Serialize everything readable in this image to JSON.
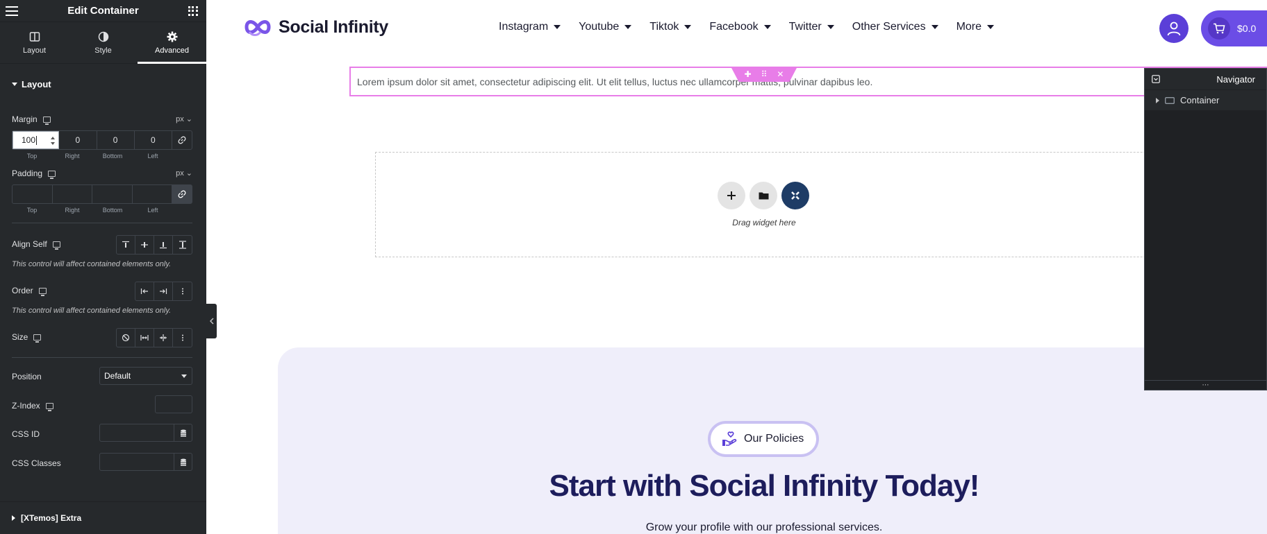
{
  "panel": {
    "title": "Edit Container",
    "tabs": [
      {
        "label": "Layout"
      },
      {
        "label": "Style"
      },
      {
        "label": "Advanced"
      }
    ],
    "section_title": "Layout",
    "margin": {
      "label": "Margin",
      "unit": "px",
      "values": [
        "100",
        "0",
        "0",
        "0"
      ],
      "sub_labels": [
        "Top",
        "Right",
        "Bottom",
        "Left"
      ]
    },
    "padding": {
      "label": "Padding",
      "unit": "px",
      "values": [
        "",
        "",
        "",
        ""
      ],
      "sub_labels": [
        "Top",
        "Right",
        "Bottom",
        "Left"
      ]
    },
    "align_self": {
      "label": "Align Self",
      "hint": "This control will affect contained elements only."
    },
    "order": {
      "label": "Order",
      "hint": "This control will affect contained elements only."
    },
    "size": {
      "label": "Size"
    },
    "position": {
      "label": "Position",
      "value": "Default"
    },
    "z_index": {
      "label": "Z-Index"
    },
    "css_id": {
      "label": "CSS ID"
    },
    "css_classes": {
      "label": "CSS Classes"
    },
    "extra": "[XTemos] Extra"
  },
  "site": {
    "logo_text": "Social Infinity",
    "nav": [
      "Instagram",
      "Youtube",
      "Tiktok",
      "Facebook",
      "Twitter",
      "Other Services",
      "More"
    ],
    "cart_total": "$0.0",
    "lorem": "Lorem ipsum dolor sit amet, consectetur adipiscing elit. Ut elit tellus, luctus nec ullamcorper mattis, pulvinar dapibus leo.",
    "drop_text": "Drag widget here",
    "policies_badge": "Our Policies",
    "headline": "Start with Social Infinity Today!",
    "subheadline": "Grow your profile with our professional services."
  },
  "navigator": {
    "title": "Navigator",
    "items": [
      "Container"
    ]
  },
  "colors": {
    "panel_bg": "#26292c",
    "accent_pink": "#e87de8",
    "brand_purple": "#6b4de6",
    "headline_navy": "#1d1d5c"
  }
}
